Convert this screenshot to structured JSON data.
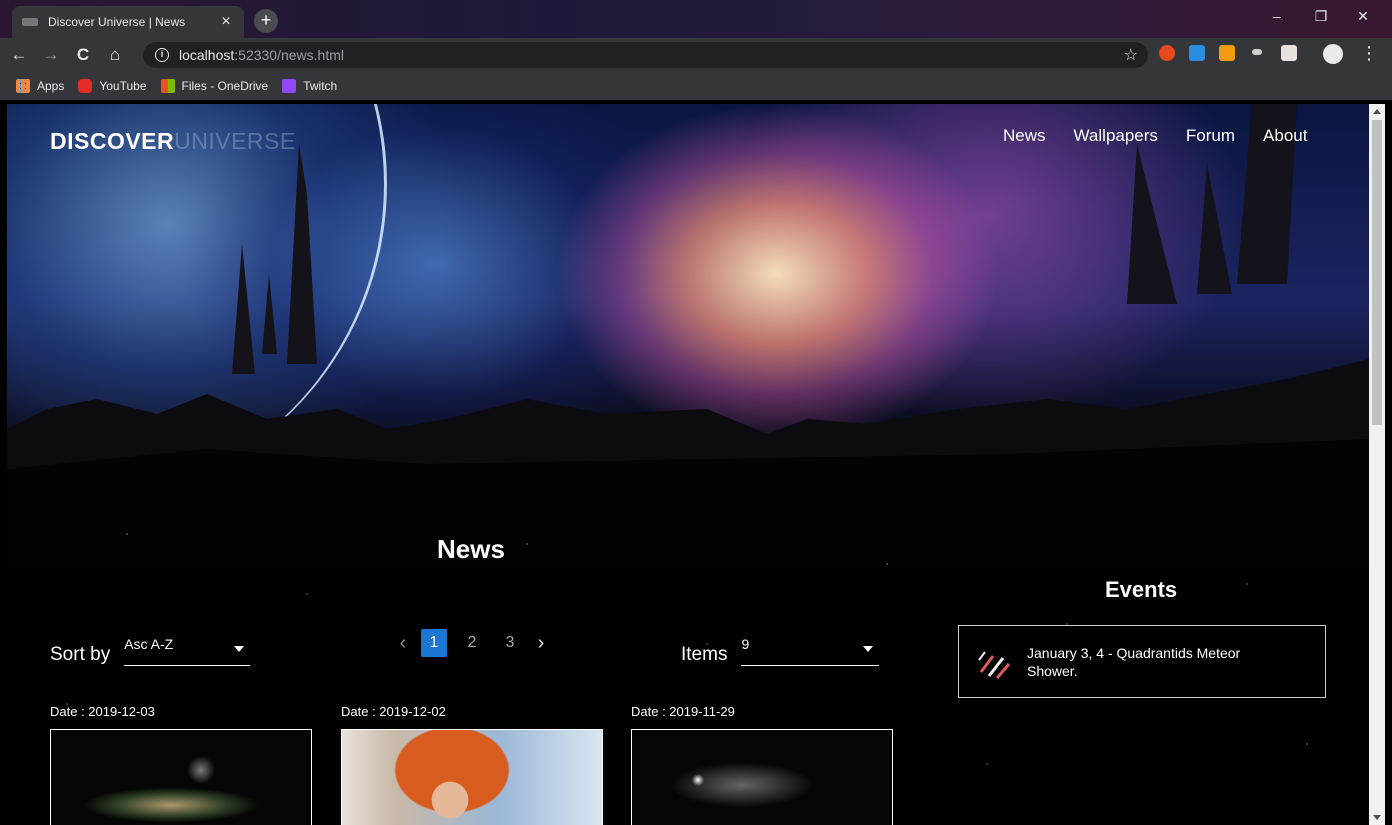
{
  "browser": {
    "tab_title": "Discover Universe | News",
    "tab_close": "×",
    "new_tab": "+",
    "url_host": "localhost",
    "url_path": ":52330/news.html",
    "star": "☆",
    "menu": "⋮",
    "back": "←",
    "forward": "→",
    "reload": "C",
    "home": "⌂",
    "min": "–",
    "max": "❐",
    "close": "✕",
    "bookmarks": [
      "Apps",
      "YouTube",
      "Files - OneDrive",
      "Twitch"
    ]
  },
  "site": {
    "logo_a": "DISCOVER",
    "logo_b": "UNIVERSE",
    "nav": [
      "News",
      "Wallpapers",
      "Forum",
      "About"
    ]
  },
  "news": {
    "title": "News",
    "sort_label": "Sort by",
    "sort_value": "Asc A-Z",
    "pages": [
      "1",
      "2",
      "3"
    ],
    "current_page": "1",
    "prev": "‹",
    "next": "›",
    "items_label": "Items",
    "items_value": "9",
    "cards": [
      {
        "date": "Date : 2019-12-03"
      },
      {
        "date": "Date : 2019-12-02"
      },
      {
        "date": "Date : 2019-11-29"
      }
    ]
  },
  "events": {
    "title": "Events",
    "list": [
      {
        "text": "January 3, 4 - Quadrantids Meteor Shower."
      }
    ]
  },
  "colors": {
    "accent": "#1976d2"
  }
}
